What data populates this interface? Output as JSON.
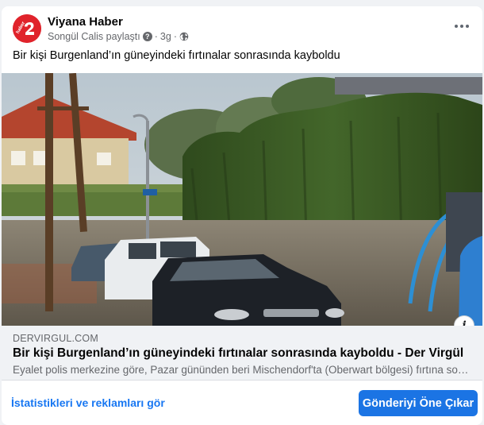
{
  "post": {
    "page_name": "Viyana Haber",
    "avatar_text": "haber",
    "shared_by": "Songül Calis paylaştı",
    "separator": "·",
    "time_ago": "3g",
    "text": "Bir kişi Burgenland’ın güneyindeki fırtınalar sonrasında kayboldu"
  },
  "link_preview": {
    "domain": "DERVIRGUL.COM",
    "title": "Bir kişi Burgenland’ın güneyindeki fırtınalar sonrasında kayboldu - Der Virgül",
    "description": "Eyalet polis merkezine göre, Pazar gününden beri Mischendorf'ta (Oberwart bölgesi) fırtına sonrası bir kişi kayıp."
  },
  "footer": {
    "stats_link": "İstatistikleri ve reklamları gör",
    "boost_button": "Gönderiyi Öne Çıkar"
  },
  "icons": {
    "more": "more-horizontal-icon",
    "help": "question-icon",
    "audience": "globe-icon",
    "info": "info-icon"
  },
  "colors": {
    "brand_red": "#e0232b",
    "link_blue": "#1877f2",
    "button_blue": "#1b74e4",
    "secondary_text": "#65676b"
  }
}
